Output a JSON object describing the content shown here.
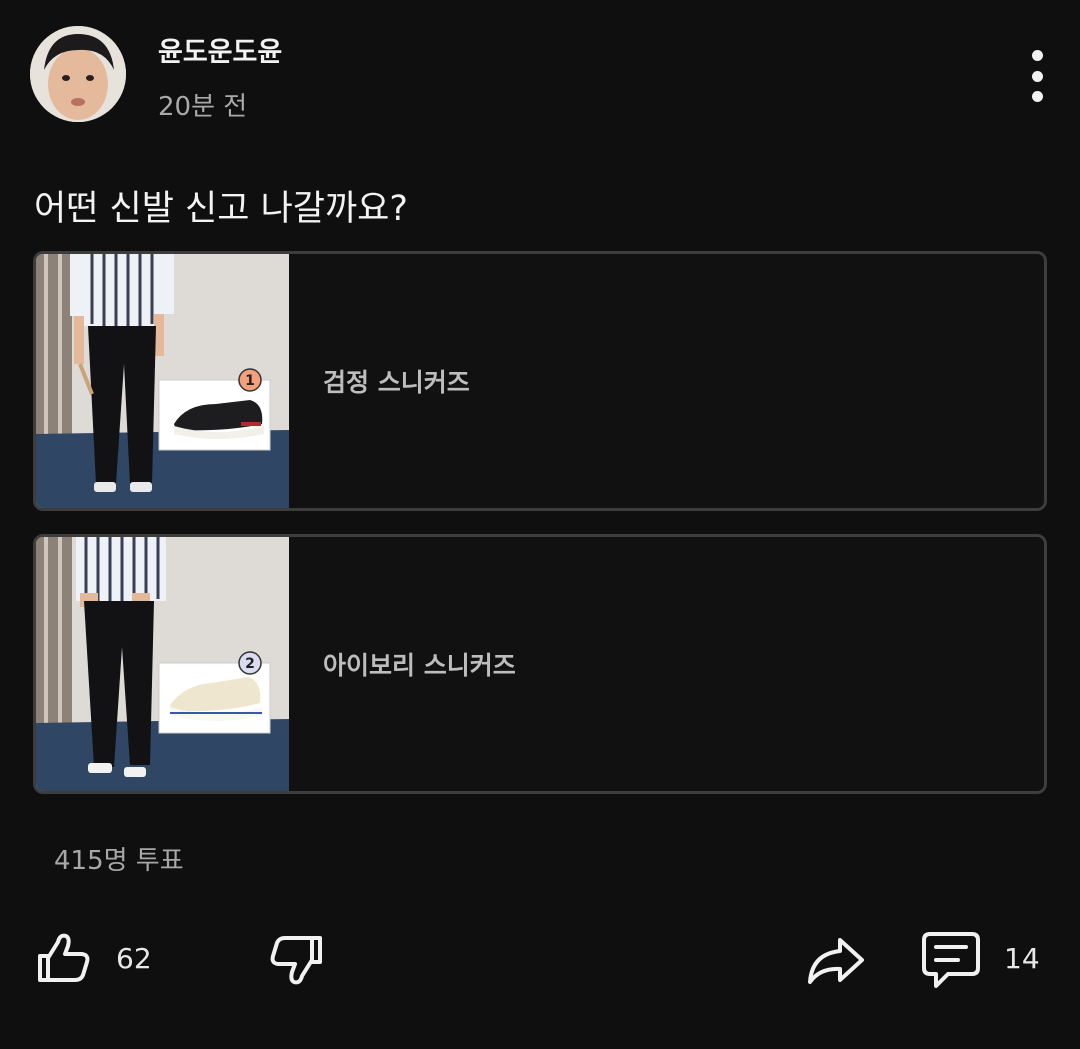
{
  "post": {
    "author": "윤도운도윤",
    "time": "20분 전",
    "question": "어떤 신발 신고 나갈까요?"
  },
  "poll": {
    "options": [
      {
        "label": "검정 스니커즈",
        "badge": "1",
        "badge_color": "#f4a07a"
      },
      {
        "label": "아이보리 스니커즈",
        "badge": "2",
        "badge_color": "#dcdcf0"
      }
    ],
    "votes": "415명 투표"
  },
  "actions": {
    "like_count": "62",
    "comment_count": "14",
    "icons": [
      "thumbs-up-icon",
      "thumbs-down-icon",
      "share-icon",
      "comment-icon",
      "more-vert-icon"
    ]
  }
}
